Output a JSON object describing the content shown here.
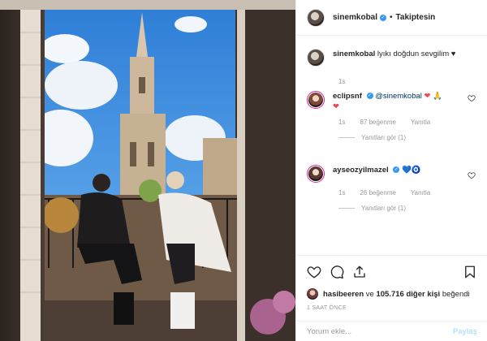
{
  "post": {
    "username": "sinemkobal",
    "follow_status": "Takiptesin",
    "caption": "lyıkı doğdun sevgilim",
    "caption_emoji": "♥",
    "caption_time": "1s"
  },
  "comments": [
    {
      "username": "eclipsnf",
      "mention": "@sinemkobal",
      "emoji": "❤ 🙏",
      "emoji2": "❤",
      "time": "1s",
      "likes": "87 beğenme",
      "reply_label": "Yanıtla",
      "view_replies": "Yanıtları gör (1)"
    },
    {
      "username": "ayseozyilmazel",
      "emoji": "💙🧿",
      "time": "1s",
      "likes": "26 beğenme",
      "reply_label": "Yanıtla",
      "view_replies": "Yanıtları gör (1)"
    }
  ],
  "likes_summary": {
    "user": "hasibeeren",
    "connector": " ve ",
    "others": "105.716 diğer kişi",
    "suffix": " beğendi"
  },
  "posted_ago": "1 SAAT ÖNCE",
  "add_comment": {
    "placeholder": "Yorum ekle...",
    "share_label": "Paylaş"
  },
  "icons": [
    "heart-icon",
    "comment-icon",
    "share-icon",
    "bookmark-icon"
  ],
  "colors": {
    "verified": "#3897f0",
    "share_disabled": "#b2dffc",
    "red_heart": "#ed4956"
  }
}
